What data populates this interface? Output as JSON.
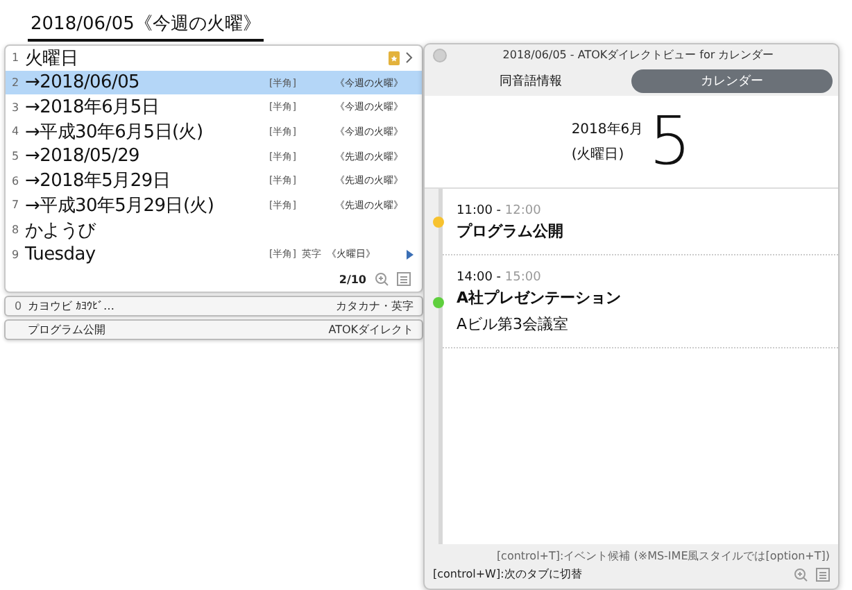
{
  "composition": {
    "text": "2018/06/05《今週の火曜》"
  },
  "candidates": [
    {
      "number": "1",
      "text": "火曜日",
      "selected": false
    },
    {
      "number": "2",
      "text": "→2018/06/05",
      "width_tag": "[半角]",
      "note": "《今週の火曜》",
      "selected": true
    },
    {
      "number": "3",
      "text": "→2018年6月5日",
      "width_tag": "[半角]",
      "note": "《今週の火曜》",
      "selected": false
    },
    {
      "number": "4",
      "text": "→平成30年6月5日(火)",
      "width_tag": "[半角]",
      "note": "《今週の火曜》",
      "selected": false
    },
    {
      "number": "5",
      "text": "→2018/05/29",
      "width_tag": "[半角]",
      "note": "《先週の火曜》",
      "selected": false
    },
    {
      "number": "6",
      "text": "→2018年5月29日",
      "width_tag": "[半角]",
      "note": "《先週の火曜》",
      "selected": false
    },
    {
      "number": "7",
      "text": "→平成30年5月29日(火)",
      "width_tag": "[半角]",
      "note": "《先週の火曜》",
      "selected": false
    },
    {
      "number": "8",
      "text": "かようび",
      "selected": false
    },
    {
      "number": "9",
      "text": "Tuesday",
      "width_tag": "[半角]",
      "script": "英字",
      "note": "《火曜日》",
      "selected": false
    }
  ],
  "page": "2/10",
  "extra_rows": [
    {
      "number": "0",
      "text": "カヨウビ ｶﾖｳﾋﾞ…",
      "right": "カタカナ・英字"
    },
    {
      "text": "プログラム公開",
      "right": "ATOKダイレクト"
    }
  ],
  "view": {
    "title": "2018/06/05 - ATOKダイレクトビュー for カレンダー",
    "tabs": [
      {
        "label": "同音語情報",
        "selected": false
      },
      {
        "label": "カレンダー",
        "selected": true
      }
    ],
    "date": {
      "year_month": "2018年6月",
      "weekday": "(火曜日)",
      "day": "5"
    },
    "events": [
      {
        "start": "11:00 -",
        "end": "12:00",
        "title": "プログラム公開",
        "color": "#f7c22f"
      },
      {
        "start": "14:00 -",
        "end": "15:00",
        "title": "A社プレゼンテーション",
        "location": "Aビル第3会議室",
        "color": "#5fcf3e"
      }
    ],
    "hint": "[control+T]:イベント候補 (※MS-IME風スタイルでは[option+T])",
    "shortcut": "[control+W]:次のタブに切替"
  }
}
